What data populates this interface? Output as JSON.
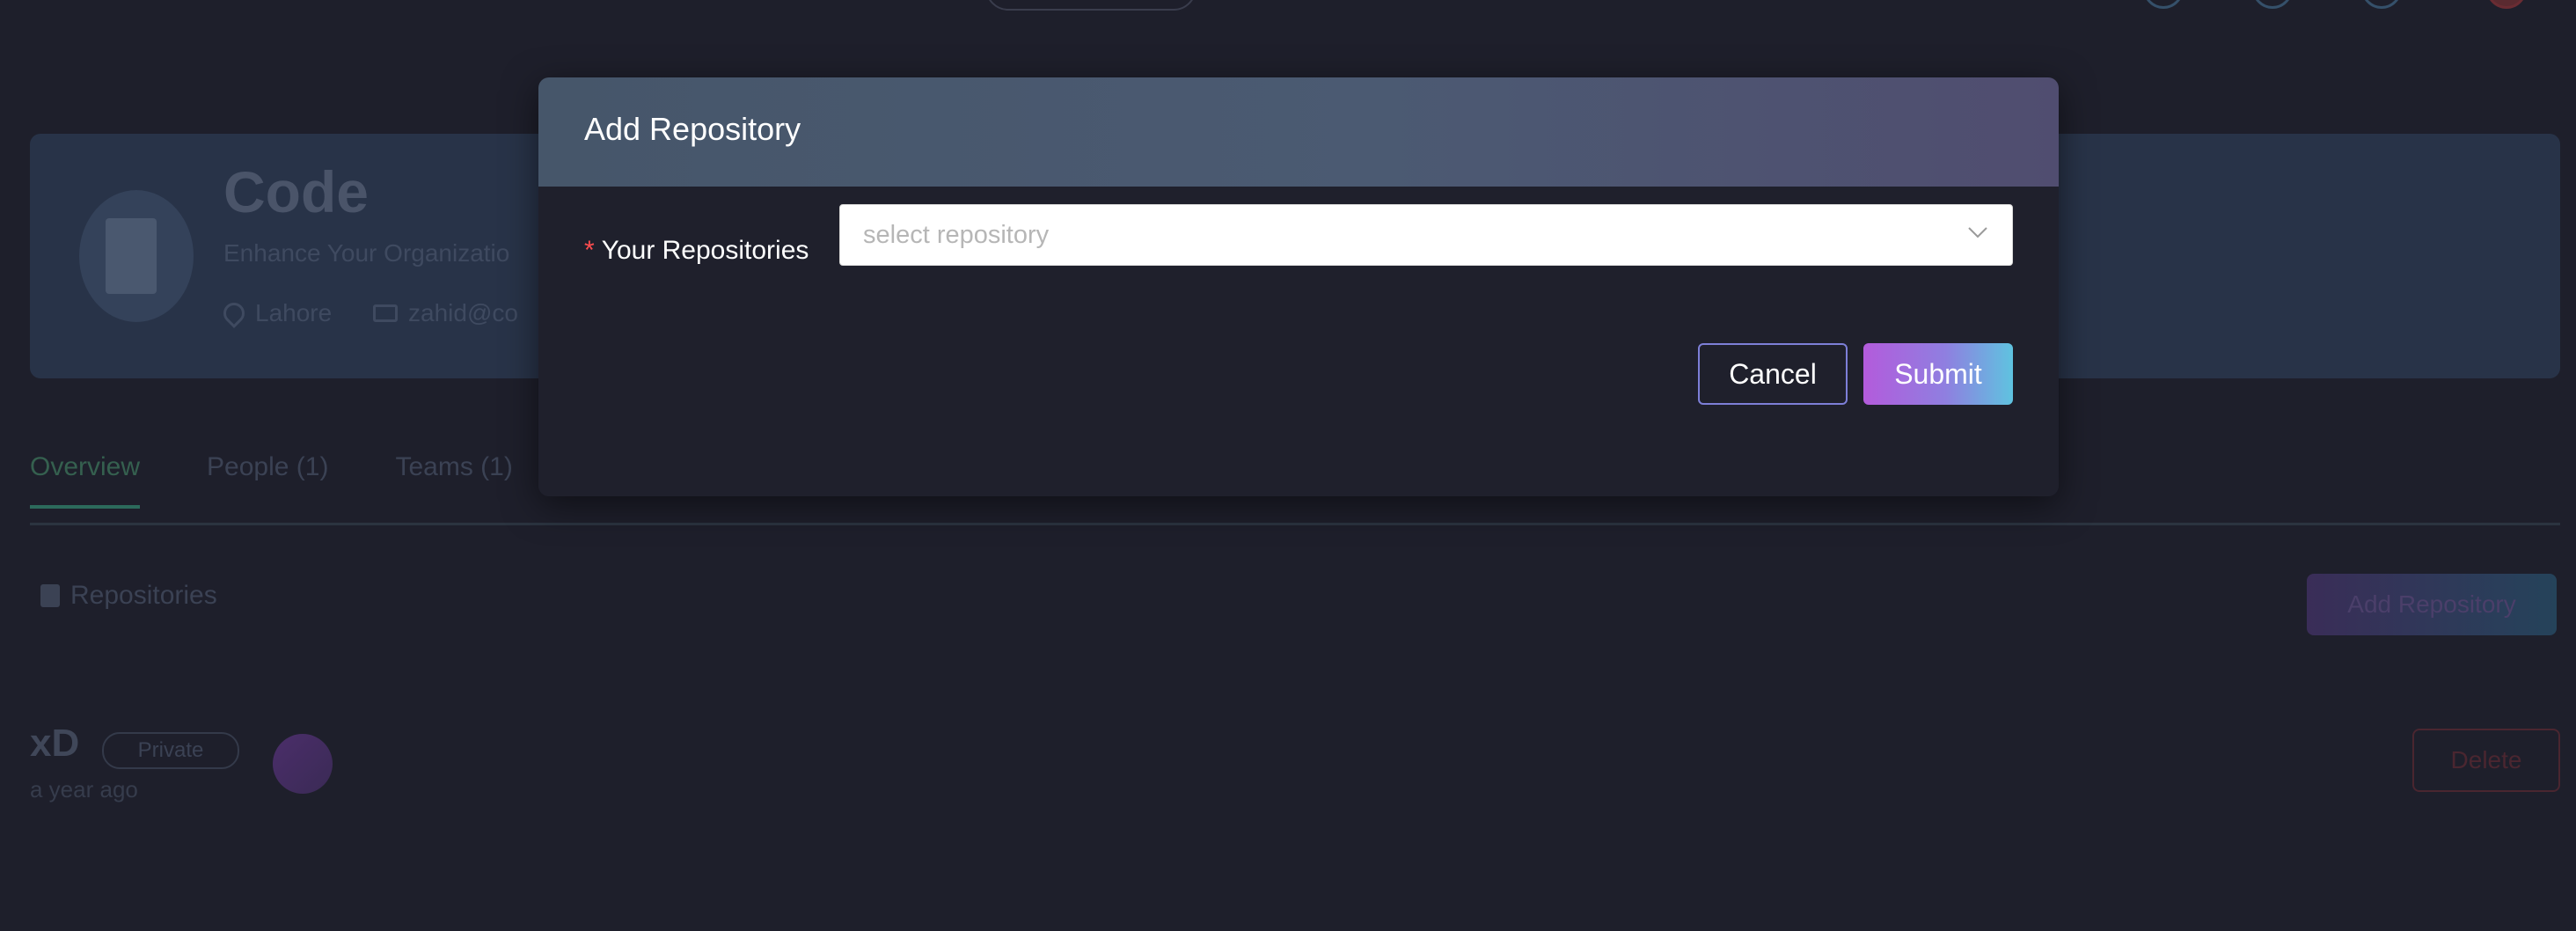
{
  "background": {
    "org": {
      "name": "Code",
      "tagline": "Enhance Your Organizatio",
      "location": "Lahore",
      "email": "zahid@co"
    },
    "tabs": [
      {
        "label": "Overview"
      },
      {
        "label": "People",
        "count": "(1)"
      },
      {
        "label": "Teams",
        "count": "(1)"
      }
    ],
    "section_title": "Repositories",
    "add_repo_label": "Add Repository",
    "repo": {
      "name": "xD",
      "visibility": "Private",
      "time": "a year ago",
      "delete_label": "Delete"
    }
  },
  "modal": {
    "title": "Add Repository",
    "field": {
      "required_mark": "*",
      "label": "Your Repositories",
      "placeholder": "select repository"
    },
    "cancel_label": "Cancel",
    "submit_label": "Submit"
  },
  "colors": {
    "accent_purple": "#b35bdc",
    "accent_cyan": "#5fc3e0",
    "required": "#ff4d4f",
    "header_gradient_start": "#46566a",
    "header_gradient_end": "#504d70"
  }
}
